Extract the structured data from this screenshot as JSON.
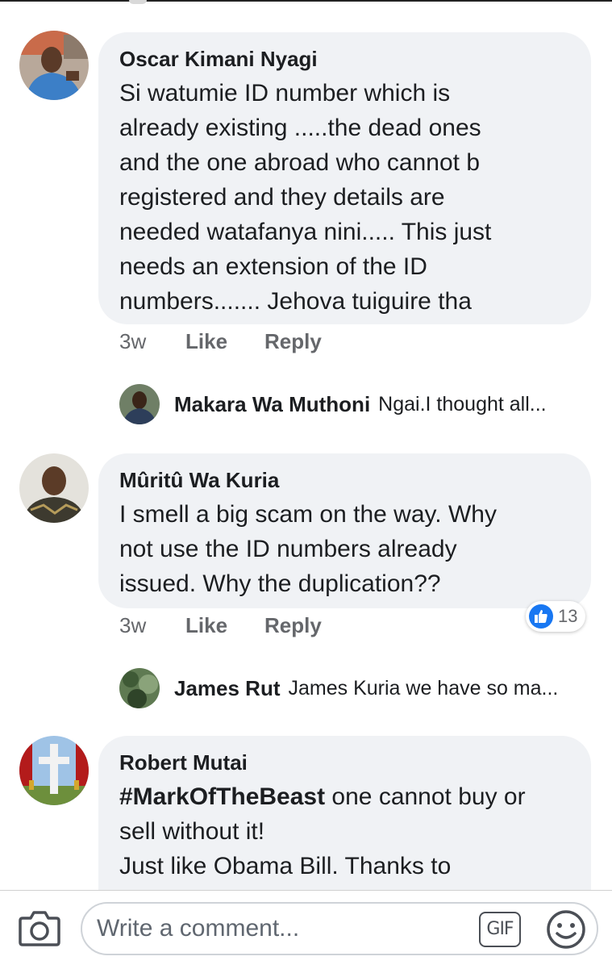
{
  "comments": [
    {
      "author": "Oscar Kimani Nyagi",
      "text": "Si watumie ID number which is\nalready existing .....the dead ones\nand the one abroad who cannot b\nregistered and they details are\nneeded watafanya nini..... This just\nneeds an extension of the ID\nnumbers....... Jehova tuiguire tha",
      "time": "3w",
      "like_label": "Like",
      "reply_label": "Reply",
      "reply_preview": {
        "author": "Makara Wa Muthoni",
        "text": "Ngai.I thought all..."
      }
    },
    {
      "author": "Mûritû Wa Kuria",
      "text": "I smell a big scam on the way. Why\nnot use the ID numbers already\nissued. Why the duplication??",
      "time": "3w",
      "like_label": "Like",
      "reply_label": "Reply",
      "reaction_count": "13",
      "reply_preview": {
        "author": "James Rut",
        "text": "James Kuria we have so ma..."
      }
    },
    {
      "author": "Robert Mutai",
      "hashtag": "#MarkOfTheBeast",
      "text_after_hashtag": " one cannot buy or\nsell without it!\nJust like Obama Bill. Thanks to"
    }
  ],
  "composer": {
    "placeholder": "Write a comment...",
    "gif_label": "GIF"
  },
  "icons": {
    "camera": "camera-icon",
    "gif": "gif-icon",
    "emoji": "emoji-icon",
    "like": "thumbs-up-icon"
  },
  "colors": {
    "bubble": "#f0f2f5",
    "meta_text": "#65676b",
    "like_blue": "#1877f2"
  }
}
